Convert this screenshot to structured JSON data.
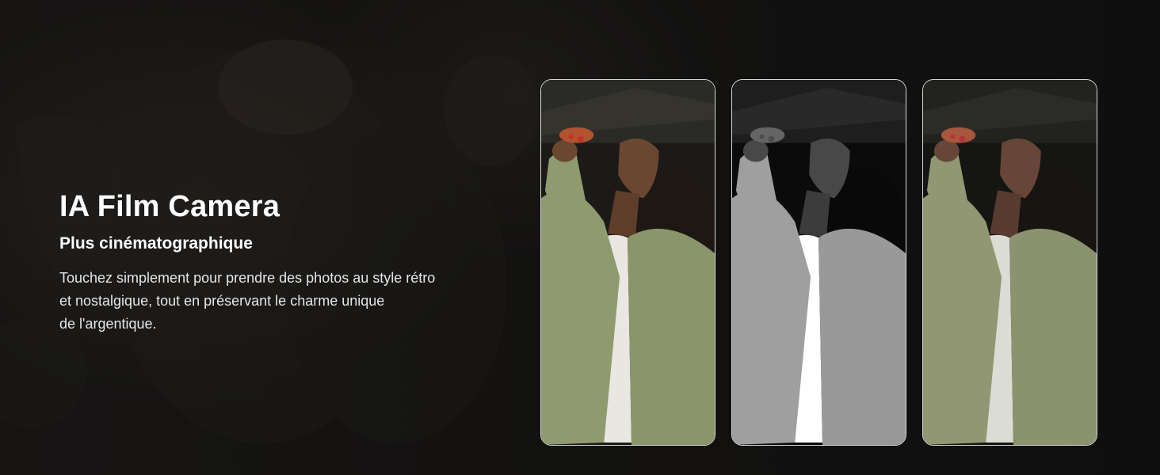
{
  "hero": {
    "title": "IA Film Camera",
    "subtitle": "Plus cinématographique",
    "description_lines": [
      "Touchez simplement pour prendre des photos au style rétro",
      "et nostalgique, tout en préservant le charme unique",
      "de l'argentique."
    ]
  },
  "samples": [
    {
      "filter": "original-color"
    },
    {
      "filter": "black-and-white"
    },
    {
      "filter": "warm-film"
    }
  ],
  "colors": {
    "background": "#121212",
    "text": "#ffffff",
    "card_border": "#d8d8d8",
    "jacket": "#8f9a6f",
    "skin": "#6b4631",
    "hair": "#1e1714"
  }
}
